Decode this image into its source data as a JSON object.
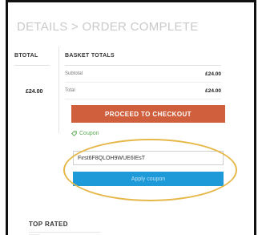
{
  "breadcrumb": "DETAILS > ORDER COMPLETE",
  "left_column": {
    "header": "BTOTAL",
    "amount": "£24.00"
  },
  "basket_totals": {
    "header": "BASKET TOTALS",
    "rows": [
      {
        "label": "Subtotal",
        "value": "£24.00"
      },
      {
        "label": "Total",
        "value": "£24.00"
      }
    ]
  },
  "checkout_button": "PROCEED TO CHECKOUT",
  "coupon": {
    "link_label": "Coupon",
    "input_value": "First6F8QLOH9WUE6IEsT",
    "apply_label": "Apply coupon"
  },
  "sidebar": {
    "top_rated_header": "TOP RATED"
  },
  "colors": {
    "checkout": "#d0603d",
    "apply": "#1e9ad8",
    "coupon_link": "#5fae57",
    "highlight_ellipse": "#e6b84a"
  },
  "icons": {
    "coupon": "tag-icon"
  }
}
